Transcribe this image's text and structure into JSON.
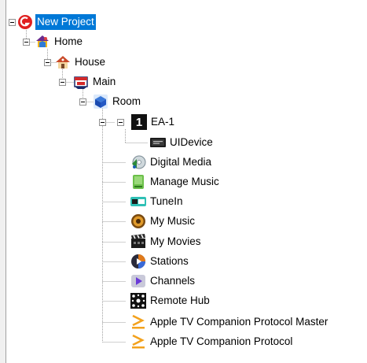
{
  "tree": {
    "nodes": [
      {
        "id": "new-project",
        "label": "New Project",
        "icon": "project-logo-icon",
        "selected": true,
        "expanded": true
      },
      {
        "id": "home",
        "label": "Home",
        "icon": "home-icon",
        "expanded": true
      },
      {
        "id": "house",
        "label": "House",
        "icon": "house-icon",
        "expanded": true
      },
      {
        "id": "main",
        "label": "Main",
        "icon": "floor-icon",
        "expanded": true
      },
      {
        "id": "room",
        "label": "Room",
        "icon": "room-cube-icon",
        "expanded": true
      },
      {
        "id": "ea-1",
        "label": "EA-1",
        "icon": "controller-icon",
        "expanded": true
      },
      {
        "id": "uidevice",
        "label": "UIDevice",
        "icon": "ui-device-icon"
      },
      {
        "id": "digital-media",
        "label": "Digital Media",
        "icon": "digital-media-icon"
      },
      {
        "id": "manage-music",
        "label": "Manage Music",
        "icon": "manage-music-icon"
      },
      {
        "id": "tunein",
        "label": "TuneIn",
        "icon": "tunein-icon"
      },
      {
        "id": "my-music",
        "label": "My Music",
        "icon": "my-music-icon"
      },
      {
        "id": "my-movies",
        "label": "My Movies",
        "icon": "my-movies-icon"
      },
      {
        "id": "stations",
        "label": "Stations",
        "icon": "stations-icon"
      },
      {
        "id": "channels",
        "label": "Channels",
        "icon": "channels-icon"
      },
      {
        "id": "remote-hub",
        "label": "Remote Hub",
        "icon": "remote-hub-icon"
      },
      {
        "id": "apple-tv-master",
        "label": "Apple TV Companion Protocol Master",
        "icon": "apple-tv-protocol-icon"
      },
      {
        "id": "apple-tv",
        "label": "Apple TV Companion Protocol",
        "icon": "apple-tv-protocol-icon"
      }
    ],
    "badges": {
      "ea1_number": "1"
    },
    "colors": {
      "selection": "#0078d7",
      "tree_line": "#a0a0a0",
      "orange_chevron": "#f3a21d"
    }
  }
}
